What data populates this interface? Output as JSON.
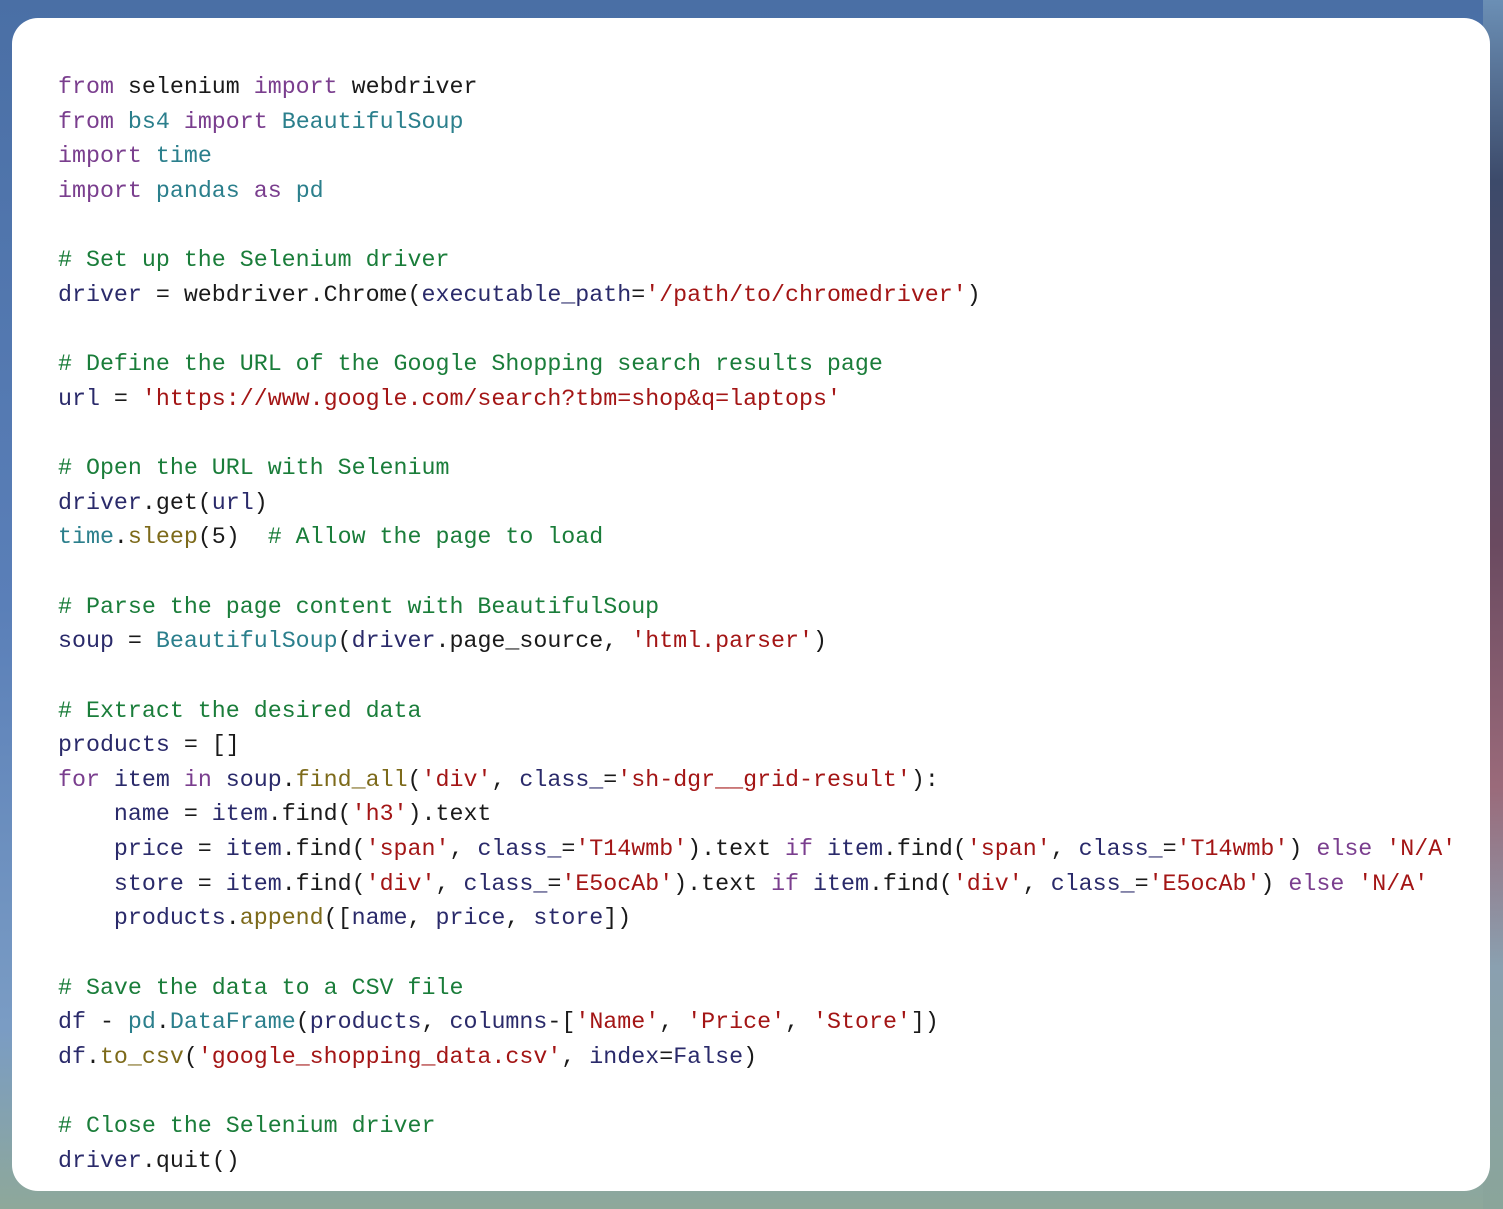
{
  "colors": {
    "keyword": "#7a3e8e",
    "module": "#2b7f8c",
    "comment": "#1a7d3a",
    "string": "#a31515",
    "variable": "#2a2a6a",
    "function": "#7d6a1a",
    "plain": "#1a1a1a",
    "card_background": "#ffffff",
    "page_background": "#5a7fb8"
  },
  "code_lines": [
    [
      {
        "t": "from",
        "c": "kw"
      },
      {
        "t": " selenium ",
        "c": "pl"
      },
      {
        "t": "import",
        "c": "kw"
      },
      {
        "t": " webdriver",
        "c": "pl"
      }
    ],
    [
      {
        "t": "from",
        "c": "kw"
      },
      {
        "t": " ",
        "c": "pl"
      },
      {
        "t": "bs4",
        "c": "mod"
      },
      {
        "t": " ",
        "c": "pl"
      },
      {
        "t": "import",
        "c": "kw"
      },
      {
        "t": " ",
        "c": "pl"
      },
      {
        "t": "BeautifulSoup",
        "c": "mod"
      }
    ],
    [
      {
        "t": "import",
        "c": "kw"
      },
      {
        "t": " ",
        "c": "pl"
      },
      {
        "t": "time",
        "c": "mod"
      }
    ],
    [
      {
        "t": "import",
        "c": "kw"
      },
      {
        "t": " ",
        "c": "pl"
      },
      {
        "t": "pandas",
        "c": "mod"
      },
      {
        "t": " ",
        "c": "pl"
      },
      {
        "t": "as",
        "c": "kw"
      },
      {
        "t": " ",
        "c": "pl"
      },
      {
        "t": "pd",
        "c": "mod"
      }
    ],
    [],
    [
      {
        "t": "# Set up the Selenium driver",
        "c": "cm"
      }
    ],
    [
      {
        "t": "driver",
        "c": "var"
      },
      {
        "t": " = webdriver.Chrome(",
        "c": "pl"
      },
      {
        "t": "executable_path",
        "c": "var"
      },
      {
        "t": "=",
        "c": "pl"
      },
      {
        "t": "'/path/to/chromedriver'",
        "c": "str"
      },
      {
        "t": ")",
        "c": "pl"
      }
    ],
    [],
    [
      {
        "t": "# Define the URL of the Google Shopping search results page",
        "c": "cm"
      }
    ],
    [
      {
        "t": "url",
        "c": "var"
      },
      {
        "t": " = ",
        "c": "pl"
      },
      {
        "t": "'https://www.google.com/search?tbm=shop&q=laptops'",
        "c": "str"
      }
    ],
    [],
    [
      {
        "t": "# Open the URL with Selenium",
        "c": "cm"
      }
    ],
    [
      {
        "t": "driver",
        "c": "var"
      },
      {
        "t": ".get(",
        "c": "pl"
      },
      {
        "t": "url",
        "c": "var"
      },
      {
        "t": ")",
        "c": "pl"
      }
    ],
    [
      {
        "t": "time",
        "c": "mod"
      },
      {
        "t": ".",
        "c": "pl"
      },
      {
        "t": "sleep",
        "c": "fn"
      },
      {
        "t": "(5)  ",
        "c": "pl"
      },
      {
        "t": "# Allow the page to load",
        "c": "cm"
      }
    ],
    [],
    [
      {
        "t": "# Parse the page content with BeautifulSoup",
        "c": "cm"
      }
    ],
    [
      {
        "t": "soup",
        "c": "var"
      },
      {
        "t": " = ",
        "c": "pl"
      },
      {
        "t": "BeautifulSoup",
        "c": "mod"
      },
      {
        "t": "(",
        "c": "pl"
      },
      {
        "t": "driver",
        "c": "var"
      },
      {
        "t": ".page_source, ",
        "c": "pl"
      },
      {
        "t": "'html.parser'",
        "c": "str"
      },
      {
        "t": ")",
        "c": "pl"
      }
    ],
    [],
    [
      {
        "t": "# Extract the desired data",
        "c": "cm"
      }
    ],
    [
      {
        "t": "products",
        "c": "var"
      },
      {
        "t": " = []",
        "c": "pl"
      }
    ],
    [
      {
        "t": "for",
        "c": "kw"
      },
      {
        "t": " ",
        "c": "pl"
      },
      {
        "t": "item",
        "c": "var"
      },
      {
        "t": " ",
        "c": "pl"
      },
      {
        "t": "in",
        "c": "kw"
      },
      {
        "t": " ",
        "c": "pl"
      },
      {
        "t": "soup",
        "c": "var"
      },
      {
        "t": ".",
        "c": "pl"
      },
      {
        "t": "find_all",
        "c": "fn"
      },
      {
        "t": "(",
        "c": "pl"
      },
      {
        "t": "'div'",
        "c": "str"
      },
      {
        "t": ", ",
        "c": "pl"
      },
      {
        "t": "class_",
        "c": "var"
      },
      {
        "t": "=",
        "c": "pl"
      },
      {
        "t": "'sh-dgr__grid-result'",
        "c": "str"
      },
      {
        "t": "):",
        "c": "pl"
      }
    ],
    [
      {
        "t": "    ",
        "c": "pl"
      },
      {
        "t": "name",
        "c": "var"
      },
      {
        "t": " = ",
        "c": "pl"
      },
      {
        "t": "item",
        "c": "var"
      },
      {
        "t": ".find(",
        "c": "pl"
      },
      {
        "t": "'h3'",
        "c": "str"
      },
      {
        "t": ").text",
        "c": "pl"
      }
    ],
    [
      {
        "t": "    ",
        "c": "pl"
      },
      {
        "t": "price",
        "c": "var"
      },
      {
        "t": " = ",
        "c": "pl"
      },
      {
        "t": "item",
        "c": "var"
      },
      {
        "t": ".find(",
        "c": "pl"
      },
      {
        "t": "'span'",
        "c": "str"
      },
      {
        "t": ", ",
        "c": "pl"
      },
      {
        "t": "class_",
        "c": "var"
      },
      {
        "t": "=",
        "c": "pl"
      },
      {
        "t": "'T14wmb'",
        "c": "str"
      },
      {
        "t": ").text ",
        "c": "pl"
      },
      {
        "t": "if",
        "c": "kw"
      },
      {
        "t": " ",
        "c": "pl"
      },
      {
        "t": "item",
        "c": "var"
      },
      {
        "t": ".find(",
        "c": "pl"
      },
      {
        "t": "'span'",
        "c": "str"
      },
      {
        "t": ", ",
        "c": "pl"
      },
      {
        "t": "class_",
        "c": "var"
      },
      {
        "t": "=",
        "c": "pl"
      },
      {
        "t": "'T14wmb'",
        "c": "str"
      },
      {
        "t": ") ",
        "c": "pl"
      },
      {
        "t": "else",
        "c": "kw"
      },
      {
        "t": " ",
        "c": "pl"
      },
      {
        "t": "'N/A'",
        "c": "str"
      }
    ],
    [
      {
        "t": "    ",
        "c": "pl"
      },
      {
        "t": "store",
        "c": "var"
      },
      {
        "t": " = ",
        "c": "pl"
      },
      {
        "t": "item",
        "c": "var"
      },
      {
        "t": ".find(",
        "c": "pl"
      },
      {
        "t": "'div'",
        "c": "str"
      },
      {
        "t": ", ",
        "c": "pl"
      },
      {
        "t": "class_",
        "c": "var"
      },
      {
        "t": "=",
        "c": "pl"
      },
      {
        "t": "'E5ocAb'",
        "c": "str"
      },
      {
        "t": ").text ",
        "c": "pl"
      },
      {
        "t": "if",
        "c": "kw"
      },
      {
        "t": " ",
        "c": "pl"
      },
      {
        "t": "item",
        "c": "var"
      },
      {
        "t": ".find(",
        "c": "pl"
      },
      {
        "t": "'div'",
        "c": "str"
      },
      {
        "t": ", ",
        "c": "pl"
      },
      {
        "t": "class_",
        "c": "var"
      },
      {
        "t": "=",
        "c": "pl"
      },
      {
        "t": "'E5ocAb'",
        "c": "str"
      },
      {
        "t": ") ",
        "c": "pl"
      },
      {
        "t": "else",
        "c": "kw"
      },
      {
        "t": " ",
        "c": "pl"
      },
      {
        "t": "'N/A'",
        "c": "str"
      }
    ],
    [
      {
        "t": "    ",
        "c": "pl"
      },
      {
        "t": "products",
        "c": "var"
      },
      {
        "t": ".",
        "c": "pl"
      },
      {
        "t": "append",
        "c": "fn"
      },
      {
        "t": "([",
        "c": "pl"
      },
      {
        "t": "name",
        "c": "var"
      },
      {
        "t": ", ",
        "c": "pl"
      },
      {
        "t": "price",
        "c": "var"
      },
      {
        "t": ", ",
        "c": "pl"
      },
      {
        "t": "store",
        "c": "var"
      },
      {
        "t": "])",
        "c": "pl"
      }
    ],
    [],
    [
      {
        "t": "# Save the data to a CSV file",
        "c": "cm"
      }
    ],
    [
      {
        "t": "df",
        "c": "var"
      },
      {
        "t": " - ",
        "c": "pl"
      },
      {
        "t": "pd",
        "c": "mod"
      },
      {
        "t": ".",
        "c": "pl"
      },
      {
        "t": "DataFrame",
        "c": "mod"
      },
      {
        "t": "(",
        "c": "pl"
      },
      {
        "t": "products",
        "c": "var"
      },
      {
        "t": ", ",
        "c": "pl"
      },
      {
        "t": "columns",
        "c": "var"
      },
      {
        "t": "-[",
        "c": "pl"
      },
      {
        "t": "'Name'",
        "c": "str"
      },
      {
        "t": ", ",
        "c": "pl"
      },
      {
        "t": "'Price'",
        "c": "str"
      },
      {
        "t": ", ",
        "c": "pl"
      },
      {
        "t": "'Store'",
        "c": "str"
      },
      {
        "t": "])",
        "c": "pl"
      }
    ],
    [
      {
        "t": "df",
        "c": "var"
      },
      {
        "t": ".",
        "c": "pl"
      },
      {
        "t": "to_csv",
        "c": "fn"
      },
      {
        "t": "(",
        "c": "pl"
      },
      {
        "t": "'google_shopping_data.csv'",
        "c": "str"
      },
      {
        "t": ", ",
        "c": "pl"
      },
      {
        "t": "index",
        "c": "var"
      },
      {
        "t": "=",
        "c": "pl"
      },
      {
        "t": "False",
        "c": "var"
      },
      {
        "t": ")",
        "c": "pl"
      }
    ],
    [],
    [
      {
        "t": "# Close the Selenium driver",
        "c": "cm"
      }
    ],
    [
      {
        "t": "driver",
        "c": "var"
      },
      {
        "t": ".quit()",
        "c": "pl"
      }
    ]
  ]
}
